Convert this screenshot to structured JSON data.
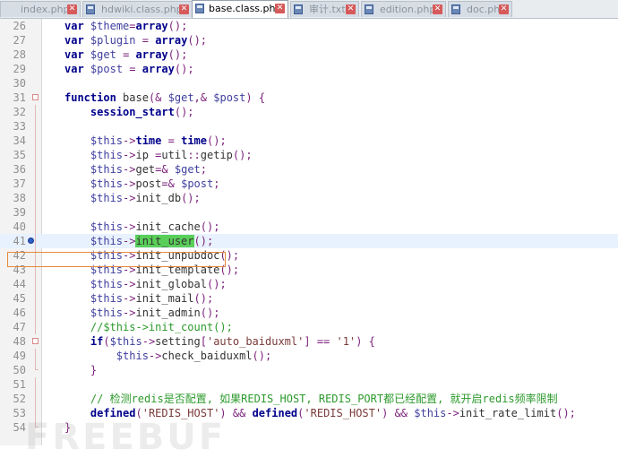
{
  "tabs": [
    {
      "label": "index.php",
      "active": false
    },
    {
      "label": "hdwiki.class.php",
      "active": false
    },
    {
      "label": "base.class.php",
      "active": true
    },
    {
      "label": "审计.txt",
      "active": false
    },
    {
      "label": "edition.php",
      "active": false
    },
    {
      "label": "doc.php",
      "active": false
    }
  ],
  "editor": {
    "current_line": 41,
    "watermark": "FREEBUF",
    "lines": [
      {
        "n": 26,
        "code": "var $theme=array();"
      },
      {
        "n": 27,
        "code": "var $plugin = array();"
      },
      {
        "n": 28,
        "code": "var $get = array();"
      },
      {
        "n": 29,
        "code": "var $post = array();"
      },
      {
        "n": 30,
        "code": ""
      },
      {
        "n": 31,
        "code": "function base(& $get,& $post) {"
      },
      {
        "n": 32,
        "code": "    session_start();"
      },
      {
        "n": 33,
        "code": ""
      },
      {
        "n": 34,
        "code": "    $this->time = time();"
      },
      {
        "n": 35,
        "code": "    $this->ip =util::getip();"
      },
      {
        "n": 36,
        "code": "    $this->get=& $get;"
      },
      {
        "n": 37,
        "code": "    $this->post=& $post;"
      },
      {
        "n": 38,
        "code": "    $this->init_db();"
      },
      {
        "n": 39,
        "code": ""
      },
      {
        "n": 40,
        "code": "    $this->init_cache();"
      },
      {
        "n": 41,
        "code": "    $this->init_user();"
      },
      {
        "n": 42,
        "code": "    $this->init_unpubdoc();"
      },
      {
        "n": 43,
        "code": "    $this->init_template();"
      },
      {
        "n": 44,
        "code": "    $this->init_global();"
      },
      {
        "n": 45,
        "code": "    $this->init_mail();"
      },
      {
        "n": 46,
        "code": "    $this->init_admin();"
      },
      {
        "n": 47,
        "code": "    //$this->init_count();"
      },
      {
        "n": 48,
        "code": "    if($this->setting['auto_baiduxml'] == '1') {"
      },
      {
        "n": 49,
        "code": "        $this->check_baiduxml();"
      },
      {
        "n": 50,
        "code": "    }"
      },
      {
        "n": 51,
        "code": ""
      },
      {
        "n": 52,
        "code": "    // 检测redis是否配置, 如果REDIS_HOST, REDIS_PORT都已经配置, 就开启redis频率限制"
      },
      {
        "n": 53,
        "code": "    defined('REDIS_HOST') && defined('REDIS_HOST') && $this->init_rate_limit();"
      },
      {
        "n": 54,
        "code": "}"
      }
    ]
  }
}
